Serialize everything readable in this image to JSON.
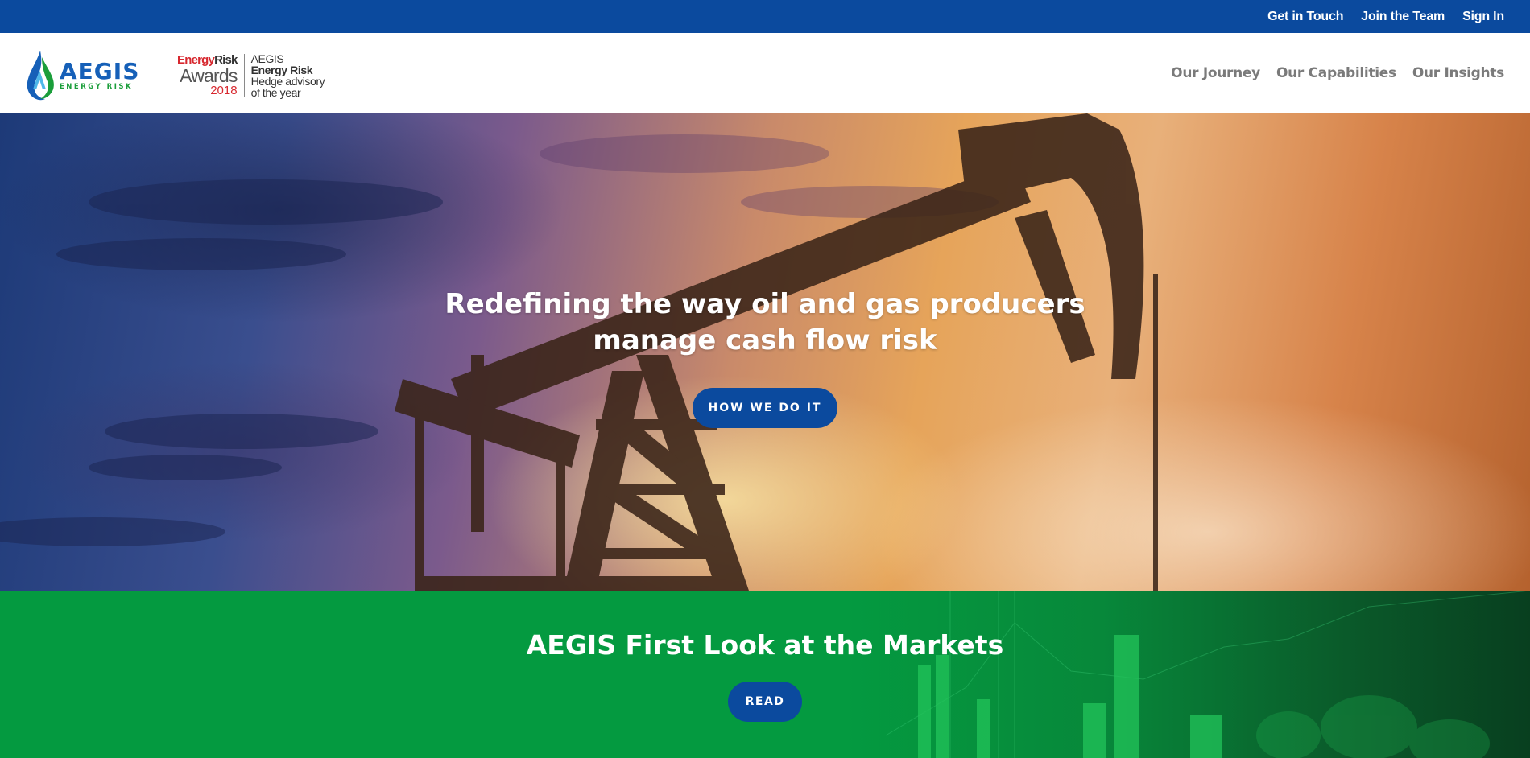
{
  "utility_nav": {
    "items": [
      {
        "label": "Get in Touch"
      },
      {
        "label": "Join the Team"
      },
      {
        "label": "Sign In"
      }
    ]
  },
  "header": {
    "logo": {
      "name": "AEGIS",
      "tagline": "ENERGY RISK"
    },
    "award": {
      "brand_red": "Energy",
      "brand_dark": "Risk",
      "awards": "Awards",
      "year": "2018",
      "line1": "AEGIS",
      "line2": "Energy Risk",
      "line3": "Hedge advisory",
      "line4": "of the year"
    },
    "main_nav": [
      {
        "label": "Our Journey"
      },
      {
        "label": "Our Capabilities"
      },
      {
        "label": "Our Insights"
      }
    ]
  },
  "hero": {
    "title": "Redefining the way oil and gas producers manage cash flow risk",
    "button_label": "HOW WE DO IT"
  },
  "market": {
    "title": "AEGIS First Look at the Markets",
    "button_label": "READ"
  },
  "colors": {
    "utility_bar": "#0b4a9e",
    "button": "#0b4a9e",
    "green_section": "#049a40",
    "nav_text": "#7a7a7a"
  }
}
